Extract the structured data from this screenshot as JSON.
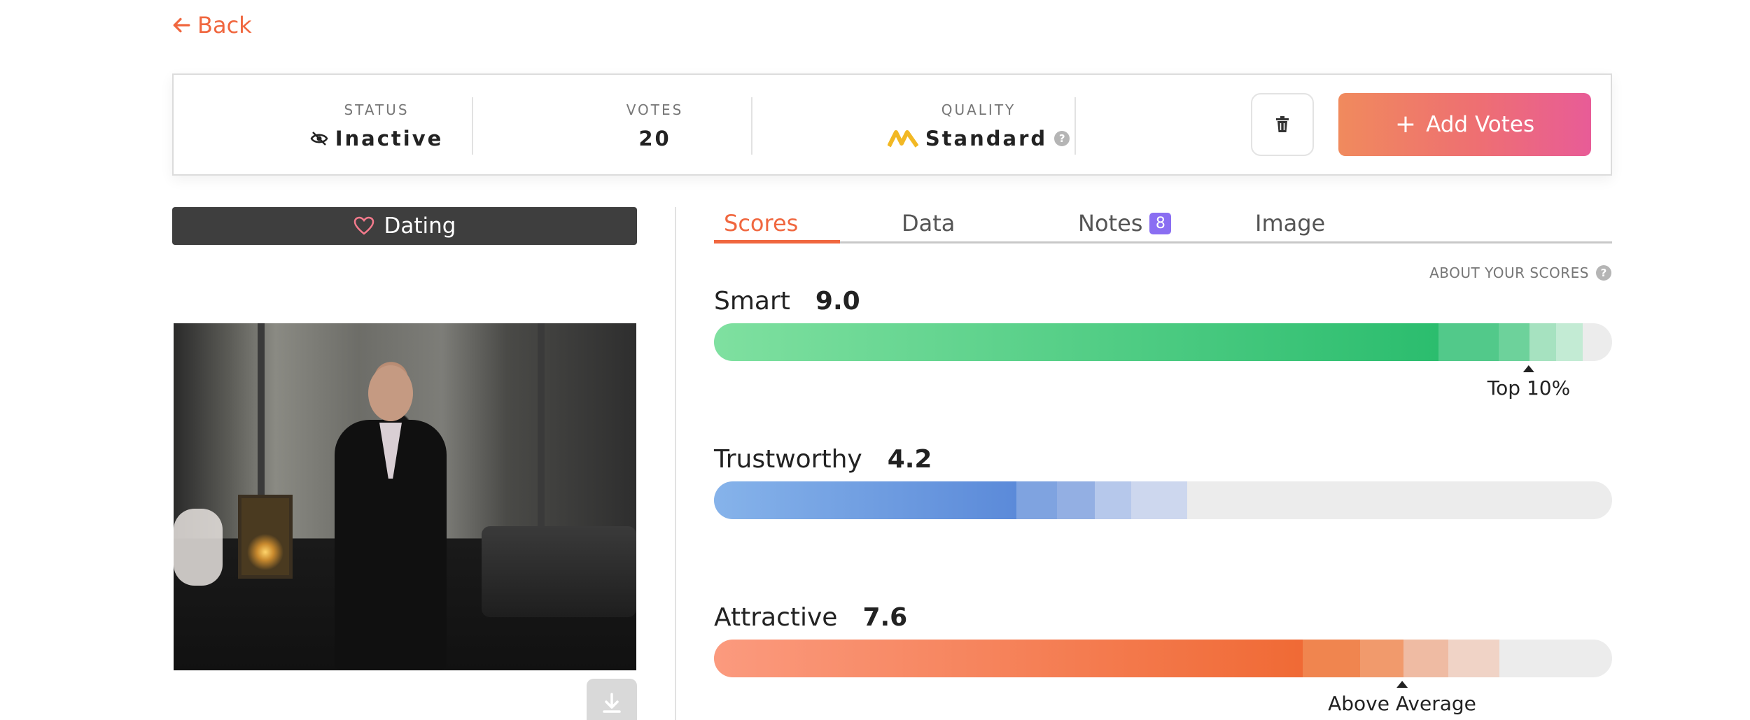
{
  "nav": {
    "back_label": "Back"
  },
  "status_card": {
    "status_label": "STATUS",
    "status_value": "Inactive",
    "votes_label": "VOTES",
    "votes_value": "20",
    "quality_label": "QUALITY",
    "quality_value": "Standard",
    "quality_help": "?",
    "add_votes_label": "Add Votes"
  },
  "category": {
    "label": "Dating"
  },
  "tabs": [
    {
      "label": "Scores",
      "active": true
    },
    {
      "label": "Data"
    },
    {
      "label": "Notes",
      "badge": "8"
    },
    {
      "label": "Image"
    }
  ],
  "about_scores": {
    "label": "ABOUT YOUR SCORES",
    "help": "?"
  },
  "scores": [
    {
      "name": "Smart",
      "value": "9.0",
      "percentile_label": "Top 10%",
      "colors": [
        "#7fe0a0",
        "#2bbd6e"
      ]
    },
    {
      "name": "Trustworthy",
      "value": "4.2",
      "percentile_label": "",
      "colors": [
        "#86b3ea",
        "#5b8ad9"
      ]
    },
    {
      "name": "Attractive",
      "value": "7.6",
      "percentile_label": "Above Average",
      "colors": [
        "#fb9a7e",
        "#f06a35"
      ]
    }
  ],
  "icons": {
    "back": "arrow-left-icon",
    "status": "eye-off-icon",
    "quality": "quality-logo-icon",
    "trash": "trash-icon",
    "add": "plus-icon",
    "category": "heart-icon",
    "download": "download-icon"
  },
  "colors": {
    "accent": "#f0673f",
    "badge": "#8a6ef2"
  }
}
